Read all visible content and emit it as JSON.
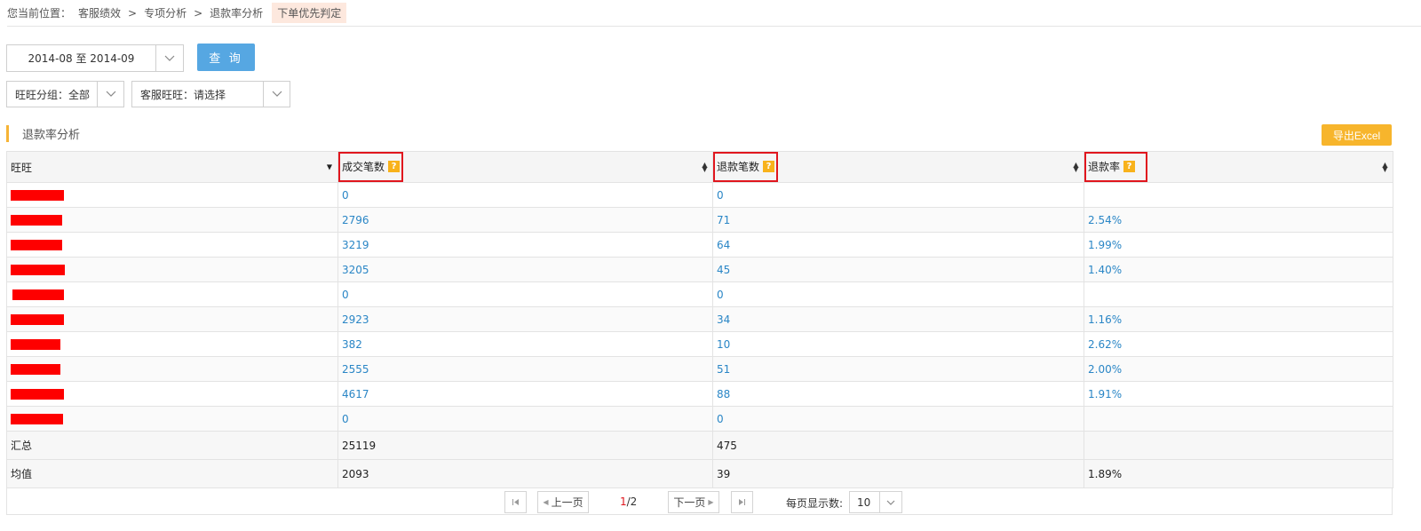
{
  "breadcrumb": {
    "label": "您当前位置：",
    "items": [
      "客服绩效",
      "专项分析",
      "退款率分析"
    ],
    "sep": ">",
    "tag": "下单优先判定"
  },
  "filters": {
    "date_range": "2014-08 至 2014-09",
    "query_label": "查 询",
    "group": "旺旺分组：全部",
    "customer_service": "客服旺旺：请选择"
  },
  "section": {
    "title": "退款率分析",
    "export_label": "导出Excel"
  },
  "table": {
    "headers": [
      "旺旺",
      "成交笔数",
      "退款笔数",
      "退款率"
    ],
    "help_glyph": "?",
    "rows": [
      {
        "name": "",
        "deals": "0",
        "refunds": "0",
        "rate": ""
      },
      {
        "name": "",
        "deals": "2796",
        "refunds": "71",
        "rate": "2.54%"
      },
      {
        "name": "",
        "deals": "3219",
        "refunds": "64",
        "rate": "1.99%"
      },
      {
        "name": "",
        "deals": "3205",
        "refunds": "45",
        "rate": "1.40%"
      },
      {
        "name": "",
        "deals": "0",
        "refunds": "0",
        "rate": ""
      },
      {
        "name": "",
        "deals": "2923",
        "refunds": "34",
        "rate": "1.16%"
      },
      {
        "name": "",
        "deals": "382",
        "refunds": "10",
        "rate": "2.62%"
      },
      {
        "name": "",
        "deals": "2555",
        "refunds": "51",
        "rate": "2.00%"
      },
      {
        "name": "",
        "deals": "4617",
        "refunds": "88",
        "rate": "1.91%"
      },
      {
        "name": "",
        "deals": "0",
        "refunds": "0",
        "rate": ""
      }
    ],
    "summary": {
      "label": "汇总",
      "deals": "25119",
      "refunds": "475",
      "rate": ""
    },
    "average": {
      "label": "均值",
      "deals": "2093",
      "refunds": "39",
      "rate": "1.89%"
    }
  },
  "pager": {
    "prev": "上一页",
    "next": "下一页",
    "current": "1",
    "total": "/2",
    "page_size_label": "每页显示数:",
    "page_size": "10"
  },
  "colors": {
    "accent": "#56a7e2",
    "export": "#f7b52c",
    "highlight": "#e0161e",
    "link": "#2a86c6",
    "redaction": "#fe0000"
  }
}
